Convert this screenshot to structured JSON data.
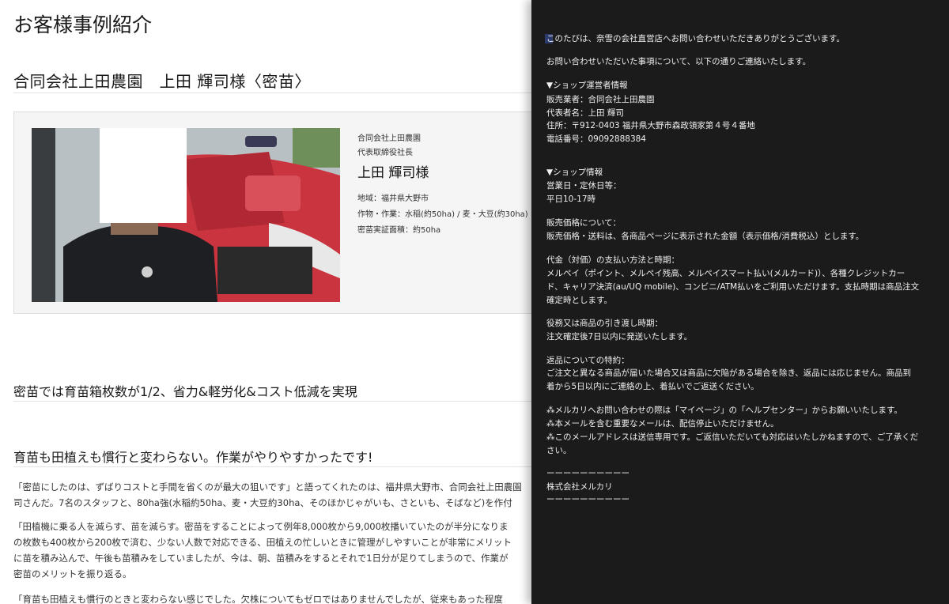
{
  "article": {
    "page_title": "お客様事例紹介",
    "case_title": "合同会社上田農園　上田 輝司様〈密苗〉",
    "profile": {
      "company": "合同会社上田農園",
      "role": "代表取締役社長",
      "name": "上田 輝司様",
      "region": "地域：福井県大野市",
      "crops": "作物・作業：水稲(約50ha) / 麦・大豆(約30ha)",
      "area": "密苗実証面積：約50ha"
    },
    "heading1": "密苗では育苗箱枚数が1/2、省力&軽労化&コスト低減を実現",
    "heading2": "育苗も田植えも慣行と変わらない。作業がやりやすかったです!",
    "paragraphs": [
      "「密苗にしたのは、ずばりコストと手間を省くのが最大の狙いです」と語ってくれたのは、福井県大野市、合同会社上田農園",
      "司さんだ。7名のスタッフと、80ha強(水稲約50ha、麦・大豆約30ha、そのほかじゃがいも、さといも、そばなど)を作付",
      "「田植機に乗る人を減らす、苗を減らす。密苗をすることによって例年8,000枚から9,000枚播いていたのが半分になりま",
      "の枚数も400枚から200枚で済む、少ない人数で対応できる、田植えの忙しいときに管理がしやすいことが非常にメリット",
      "に苗を積み込んで、午後も苗積みをしていましたが、今は、朝、苗積みをするとそれで1日分が足りてしまうので、作業が",
      "密苗のメリットを振り返る。",
      "「育苗も田植えも慣行のときと変わらない感じでした。欠株についてもゼロではありませんでしたが、従来もあった程度"
    ]
  },
  "mail": {
    "greeting": "このたびは、奈雪の会社直営店へお問い合わせいただきありがとうございます。",
    "intro": "お問い合わせいただいた事項について、以下の通りご連絡いたします。",
    "operator_header": "▼ショップ運営者情報",
    "seller": "販売業者：合同会社上田農園",
    "representative": "代表者名：上田 輝司",
    "address": "住所：〒912-0403 福井県大野市森政領家第４号４番地",
    "phone": "電話番号：09092888384",
    "shop_header": "▼ショップ情報",
    "business_days_label": "営業日・定休日等：",
    "business_days": "平日10-17時",
    "price_label": "販売価格について：",
    "price": "販売価格・送料は、各商品ページに表示された金額（表示価格/消費税込）とします。",
    "payment_label": "代金（対価）の支払い方法と時期：",
    "payment_1": "メルペイ（ポイント、メルペイ残高、メルペイスマート払い(メルカード)）、各種クレジットカー",
    "payment_2": "ド、キャリア決済(au/UQ mobile)、コンビニ/ATM払いをご利用いただけます。支払時期は商品注文",
    "payment_3": "確定時とします。",
    "delivery_label": "役務又は商品の引き渡し時期：",
    "delivery": "注文確定後7日以内に発送いたします。",
    "returns_label": "返品についての特約：",
    "returns_1": "ご注文と異なる商品が届いた場合又は商品に欠陥がある場合を除き、返品には応じません。商品到",
    "returns_2": "着から5日以内にご連絡の上、着払いでご返送ください。",
    "note_1": "⁂メルカリへお問い合わせの際は「マイページ」の「ヘルプセンター」からお願いいたします。",
    "note_2": "⁂本メールを含む重要なメールは、配信停止いただけません。",
    "note_3a": "⁂このメールアドレスは送信専用です。ご返信いただいても対応はいたしかねますので、ご了承くだ",
    "note_3b": "さい。",
    "divider_top": "ーーーーーーーーーー",
    "company": "株式会社メルカリ",
    "divider_bottom": "ーーーーーーーーーー"
  },
  "colors": {
    "mail_background": "#1b1b1b",
    "mail_text": "#f0f0f0",
    "card_background": "#f5f5f5"
  }
}
